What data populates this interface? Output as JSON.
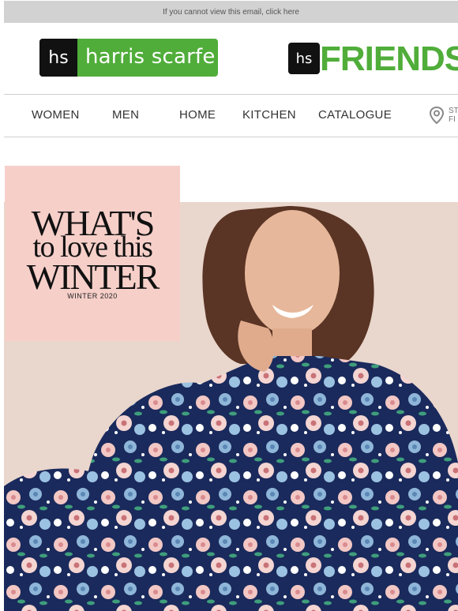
{
  "topbar": {
    "text": "If you cannot view this email, click here"
  },
  "logos": {
    "brand_mark": "hs",
    "brand_name": "harris scarfe",
    "friends_mark": "hs",
    "friends_name": "FRIENDS"
  },
  "nav": {
    "items": [
      {
        "label": "WOMEN"
      },
      {
        "label": "MEN"
      },
      {
        "label": "HOME"
      },
      {
        "label": "KITCHEN"
      },
      {
        "label": "CATALOGUE"
      }
    ],
    "store_finder": {
      "line1": "ST",
      "line2": "FI"
    }
  },
  "hero": {
    "headline_line1": "WHAT'S",
    "headline_line2": "to love this",
    "headline_line3": "WINTER",
    "subtitle": "WINTER 2020"
  },
  "colors": {
    "brand_green": "#50ad3a",
    "panel_pink": "#f6cfc9",
    "pajama_navy": "#1a2a5c"
  }
}
